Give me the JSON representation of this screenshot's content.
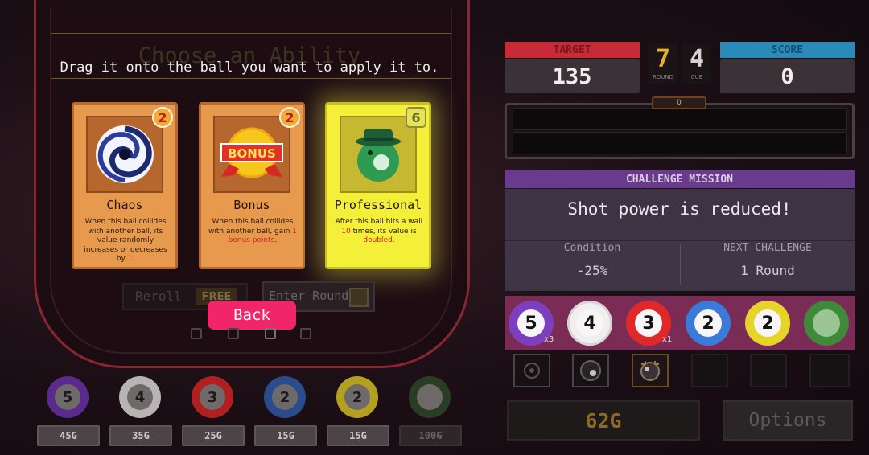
{
  "ability_panel": {
    "ghost_title": "Choose an Ability",
    "instruction": "Drag it onto the ball you want to apply it to.",
    "cards": [
      {
        "name": "Chaos",
        "badge": "2",
        "icon": "black-hole-icon",
        "desc_parts": [
          "When this ball collides with another ball, its value randomly increases or decreases by ",
          "1",
          "."
        ]
      },
      {
        "name": "Bonus",
        "badge": "2",
        "icon": "bonus-ribbon-icon",
        "icon_text": "BONUS",
        "desc_parts": [
          "When this ball collides with another ball, gain ",
          "1 bonus points",
          "."
        ]
      },
      {
        "name": "Professional",
        "badge": "6",
        "icon": "detective-ball-icon",
        "desc_parts": [
          "After this ball hits a wall ",
          "10",
          " times, its value is ",
          "doubled",
          "."
        ]
      }
    ],
    "reroll_label": "Reroll",
    "reroll_cost": "FREE",
    "enter_round_label": "Enter Round",
    "back_label": "Back"
  },
  "shop": {
    "balls": [
      {
        "number": "5",
        "color": "#5a2a8c",
        "price": "45G"
      },
      {
        "number": "4",
        "color": "#b8b4b4",
        "price": "35G"
      },
      {
        "number": "3",
        "color": "#b02020",
        "price": "25G"
      },
      {
        "number": "2",
        "color": "#2a4c8c",
        "price": "15G"
      },
      {
        "number": "2",
        "color": "#b4a020",
        "price": "15G"
      },
      {
        "number": "",
        "color": "#2a3c24",
        "price": "100G"
      }
    ]
  },
  "stats": {
    "target_label": "TARGET",
    "target_value": "135",
    "round_value": "7",
    "round_label": "ROUND",
    "cue_value": "4",
    "cue_label": "CUE",
    "score_label": "SCORE",
    "score_value": "0",
    "progress_value": "0"
  },
  "mission": {
    "header": "CHALLENGE MISSION",
    "text": "Shot power is reduced!",
    "condition_label": "Condition",
    "condition_value": "-25%",
    "next_label": "NEXT CHALLENGE",
    "next_value": "1 Round"
  },
  "ball_rack": {
    "balls": [
      {
        "number": "5",
        "color": "#7b3fc0",
        "multiplier": "x3"
      },
      {
        "number": "4",
        "color": "#f0eeee",
        "multiplier": ""
      },
      {
        "number": "3",
        "color": "#e02828",
        "multiplier": "x1"
      },
      {
        "number": "2",
        "color": "#3a7ad8",
        "multiplier": ""
      },
      {
        "number": "2",
        "color": "#e8d428",
        "multiplier": ""
      },
      {
        "number": "",
        "color": "#3e8a38",
        "multiplier": ""
      }
    ]
  },
  "gold_value": "62G",
  "options_label": "Options"
}
